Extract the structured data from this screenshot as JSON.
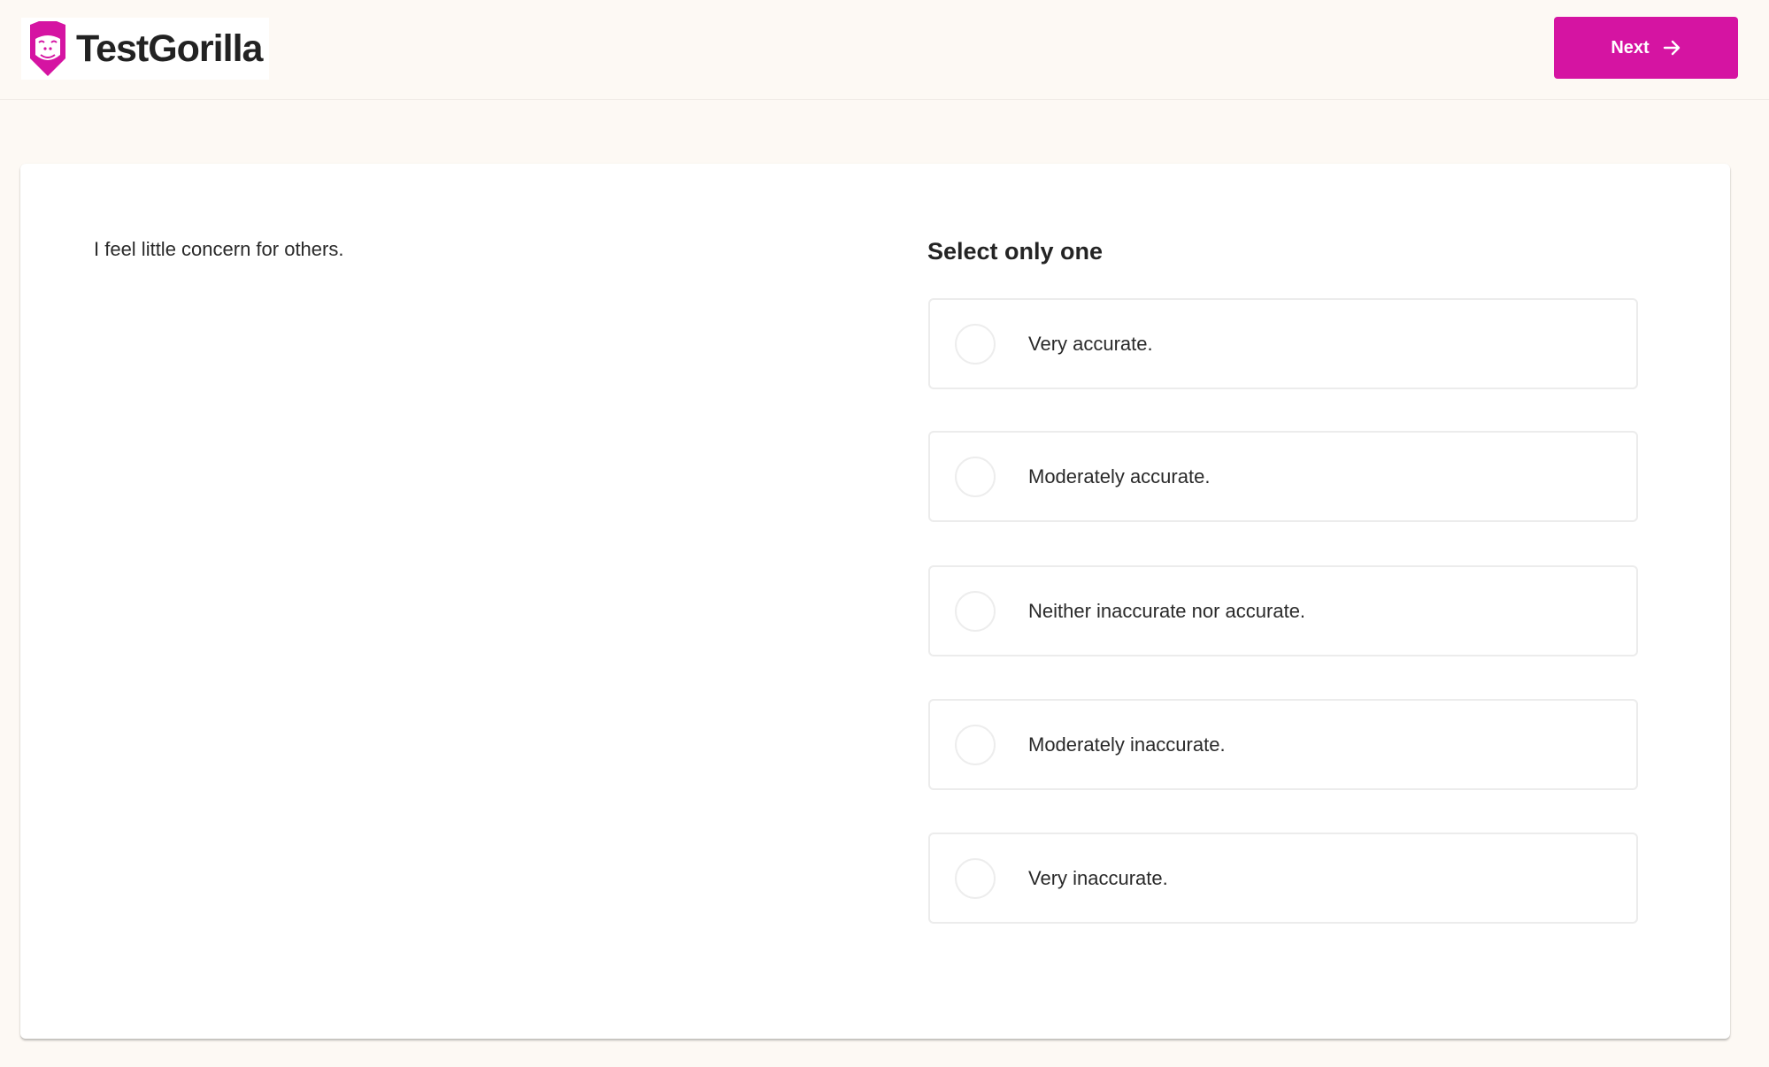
{
  "header": {
    "brand_name": "TestGorilla",
    "logo_icon": "gorilla-logo-icon",
    "next_button": {
      "label": "Next",
      "icon": "arrow-right-icon"
    }
  },
  "colors": {
    "brand": "#d514a2",
    "background": "#fdf9f4",
    "card": "#ffffff"
  },
  "question": {
    "text": "I feel little concern for others.",
    "instruction": "Select only one",
    "options": [
      {
        "label": "Very accurate.",
        "selected": false
      },
      {
        "label": "Moderately accurate.",
        "selected": false
      },
      {
        "label": "Neither inaccurate nor accurate.",
        "selected": false
      },
      {
        "label": "Moderately inaccurate.",
        "selected": false
      },
      {
        "label": "Very inaccurate.",
        "selected": false
      }
    ]
  }
}
